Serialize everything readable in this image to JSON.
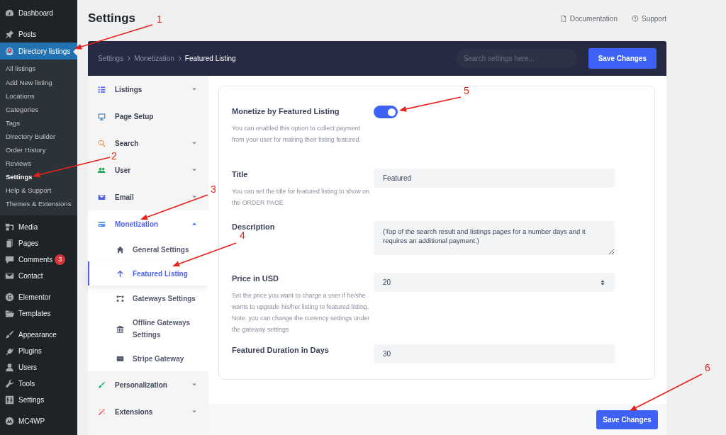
{
  "admin_menu": [
    [
      {
        "label": "Dashboard",
        "selected": false
      }
    ],
    [
      {
        "label": "Posts",
        "selected": false
      },
      {
        "label": "Directory listings",
        "selected": true,
        "submenu": [
          {
            "label": "All listings",
            "selected": false
          },
          {
            "label": "Add New listing",
            "selected": false
          },
          {
            "label": "Locations",
            "selected": false
          },
          {
            "label": "Categories",
            "selected": false
          },
          {
            "label": "Tags",
            "selected": false
          },
          {
            "label": "Directory Builder",
            "selected": false
          },
          {
            "label": "Order History",
            "selected": false
          },
          {
            "label": "Reviews",
            "selected": false
          },
          {
            "label": "Settings",
            "selected": true
          },
          {
            "label": "Help & Support",
            "selected": false
          },
          {
            "label": "Themes & Extensions",
            "selected": false
          }
        ]
      },
      {
        "label": "Media",
        "selected": false
      },
      {
        "label": "Pages",
        "selected": false
      },
      {
        "label": "Comments",
        "selected": false,
        "badge": "3"
      },
      {
        "label": "Contact",
        "selected": false
      }
    ],
    [
      {
        "label": "Elementor",
        "selected": false
      },
      {
        "label": "Templates",
        "selected": false
      }
    ],
    [
      {
        "label": "Appearance",
        "selected": false
      },
      {
        "label": "Plugins",
        "selected": false
      },
      {
        "label": "Users",
        "selected": false
      },
      {
        "label": "Tools",
        "selected": false
      },
      {
        "label": "Settings",
        "selected": false
      }
    ],
    [
      {
        "label": "MC4WP",
        "selected": false
      }
    ]
  ],
  "page_title": "Settings",
  "header_links": [
    "Documentation",
    "Support"
  ],
  "breadcrumb": [
    "Settings",
    "Monetization",
    "Featured Listing"
  ],
  "search": {
    "placeholder": "Search settings here..."
  },
  "save_button": "Save Changes",
  "settings_nav": [
    {
      "label": "Listings",
      "expanded": false
    },
    {
      "label": "Page Setup"
    },
    {
      "label": "Search",
      "expanded": false
    },
    {
      "label": "User",
      "expanded": false
    },
    {
      "label": "Email",
      "expanded": false
    },
    {
      "label": "Monetization",
      "expanded": true,
      "children": [
        {
          "label": "General Settings",
          "selected": false
        },
        {
          "label": "Featured Listing",
          "selected": true
        },
        {
          "label": "Gateways Settings",
          "selected": false
        },
        {
          "label": "Offline Gateways Settings",
          "selected": false
        },
        {
          "label": "Stripe Gateway",
          "selected": false
        }
      ]
    },
    {
      "label": "Personalization",
      "expanded": false
    },
    {
      "label": "Extensions",
      "expanded": false
    }
  ],
  "fields": [
    {
      "kind": "toggle",
      "label": "Monetize by Featured Listing",
      "description": "You can enabled this option to collect payment from your user for making their listing featured.",
      "on": true
    },
    {
      "kind": "text",
      "label": "Title",
      "description": "You can set the title for featured listing to show on the ORDER PAGE",
      "value": "Featured"
    },
    {
      "kind": "textarea",
      "label": "Description",
      "value": "(Top of the search result and listings pages for a number days and it requires an additional payment.)"
    },
    {
      "kind": "number",
      "label": "Price in USD",
      "description": "Set the price you want to charge a user if he/she wants to upgrade his/her listing to featured listing. Note: you can change the currency settings under the gateway settings",
      "value": "20"
    },
    {
      "kind": "text",
      "label": "Featured Duration in Days",
      "value": "30"
    }
  ],
  "footer_button": "Save Changes",
  "annotations": [
    {
      "label": "1"
    },
    {
      "label": "2"
    },
    {
      "label": "3"
    },
    {
      "label": "4"
    },
    {
      "label": "5"
    },
    {
      "label": "6"
    }
  ]
}
